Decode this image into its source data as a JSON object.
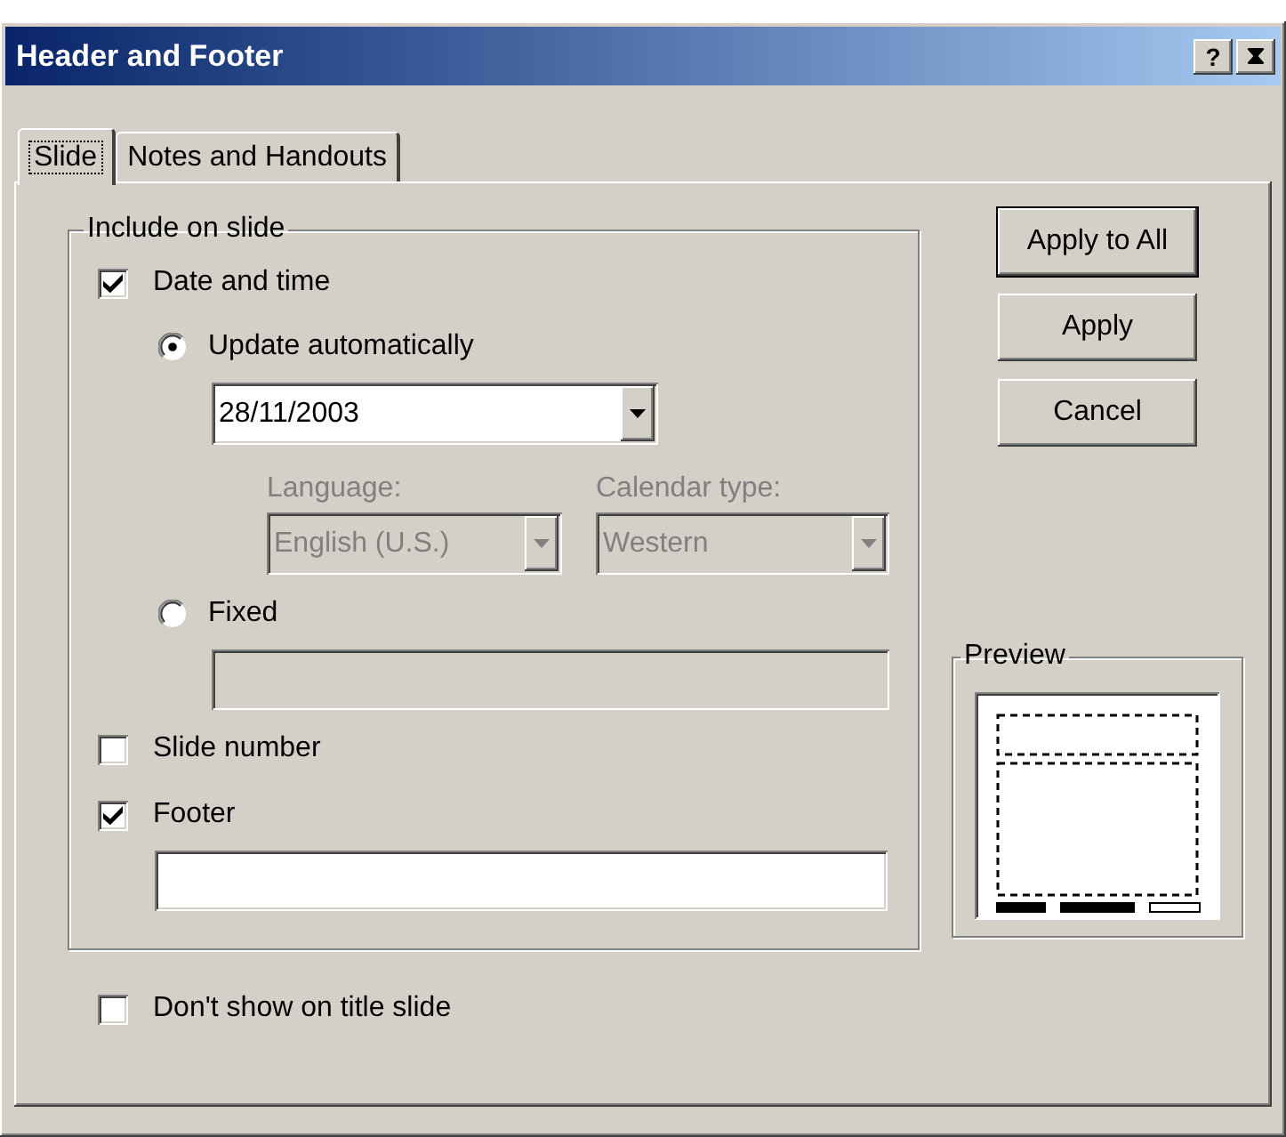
{
  "window": {
    "title": "Header and Footer",
    "help": "?"
  },
  "tabs": [
    {
      "label": "Slide",
      "selected": true
    },
    {
      "label": "Notes and Handouts",
      "selected": false
    }
  ],
  "include_group": {
    "title": "Include on slide",
    "date_and_time": {
      "label": "Date and time",
      "checked": true
    },
    "update_automatically": {
      "label": "Update automatically",
      "selected": true
    },
    "date_format": {
      "value": "28/11/2003",
      "disabled": false
    },
    "language": {
      "label": "Language:",
      "value": "English (U.S.)",
      "disabled": true
    },
    "calendar_type": {
      "label": "Calendar type:",
      "value": "Western",
      "disabled": true
    },
    "fixed": {
      "label": "Fixed",
      "selected": false
    },
    "fixed_field": {
      "disabled": true
    },
    "slide_number": {
      "label": "Slide number",
      "checked": false
    },
    "footer": {
      "label": "Footer",
      "checked": true
    },
    "footer_field": {
      "disabled": false
    }
  },
  "dont_show_on_title": {
    "label": "Don't show on title slide",
    "checked": false
  },
  "buttons": [
    {
      "label": "Apply to All",
      "default": true
    },
    {
      "label": "Apply",
      "default": false
    },
    {
      "label": "Cancel",
      "default": false
    }
  ],
  "preview": {
    "title": "Preview"
  }
}
